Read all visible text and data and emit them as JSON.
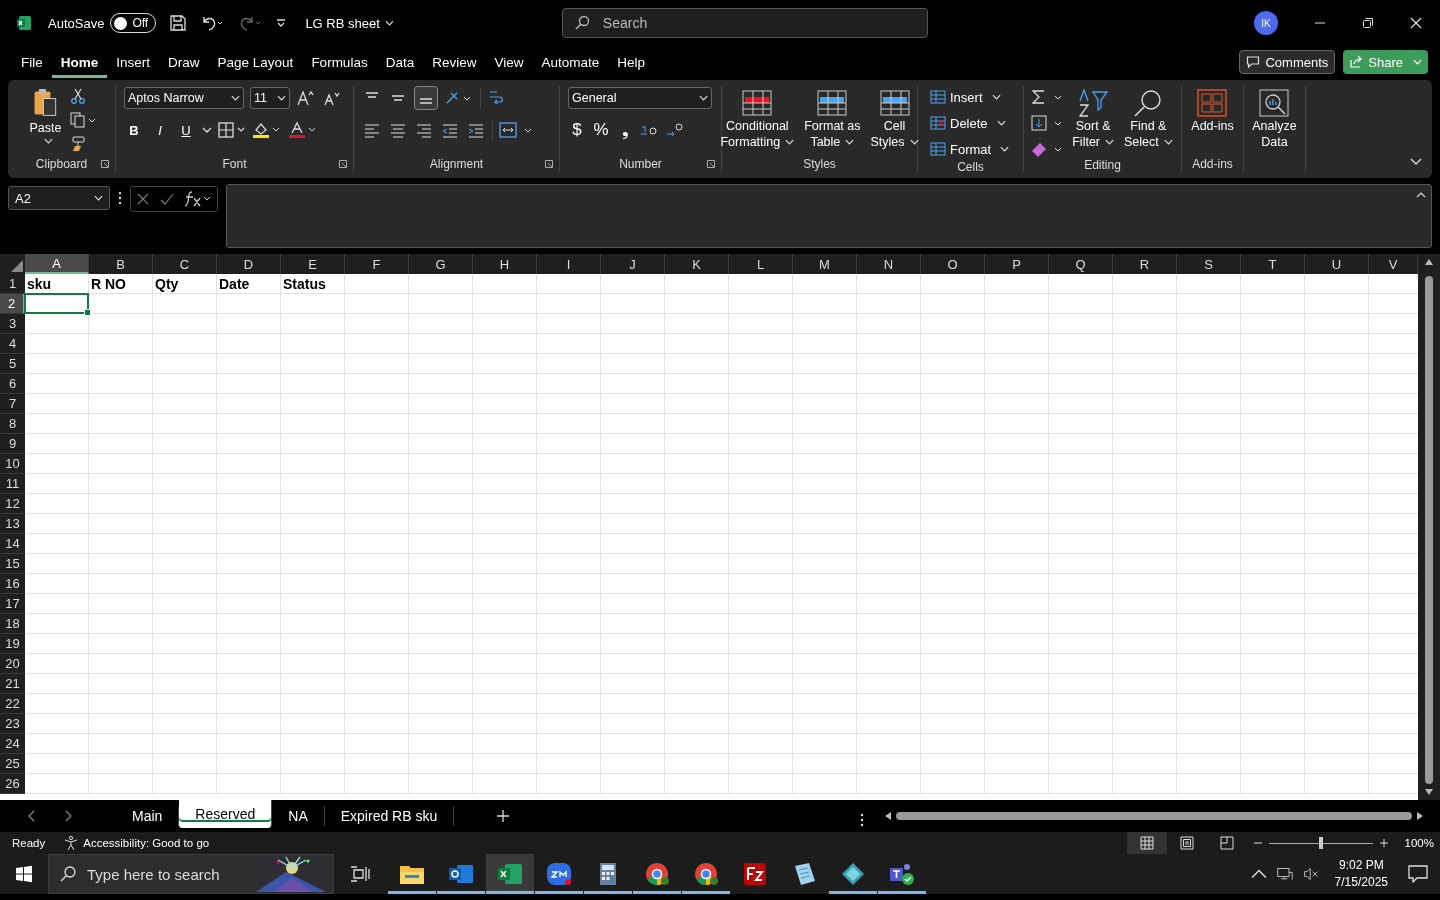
{
  "title_bar": {
    "autosave_label": "AutoSave",
    "autosave_toggle": {
      "label": "Off",
      "on": false
    },
    "document_title": "LG RB sheet",
    "search": {
      "placeholder": "Search"
    },
    "avatar": "IK"
  },
  "menu_tabs": [
    {
      "label": "File",
      "selected": false
    },
    {
      "label": "Home",
      "selected": true
    },
    {
      "label": "Insert",
      "selected": false
    },
    {
      "label": "Draw",
      "selected": false
    },
    {
      "label": "Page Layout",
      "selected": false
    },
    {
      "label": "Formulas",
      "selected": false
    },
    {
      "label": "Data",
      "selected": false
    },
    {
      "label": "Review",
      "selected": false
    },
    {
      "label": "View",
      "selected": false
    },
    {
      "label": "Automate",
      "selected": false
    },
    {
      "label": "Help",
      "selected": false
    }
  ],
  "comments_button": "Comments",
  "share_button": "Share",
  "ribbon": {
    "clipboard": {
      "paste": "Paste",
      "label": "Clipboard"
    },
    "font": {
      "name": "Aptos Narrow",
      "size": "11",
      "styles": [
        "B",
        "I",
        "U"
      ],
      "label": "Font"
    },
    "alignment": {
      "label": "Alignment"
    },
    "number": {
      "format": "General",
      "symbols": [
        "$",
        "%",
        "❟"
      ],
      "label": "Number"
    },
    "styles": {
      "buttons": [
        [
          "Conditional",
          "Formatting"
        ],
        [
          "Format as",
          "Table"
        ],
        [
          "Cell",
          "Styles"
        ]
      ],
      "label": "Styles"
    },
    "cells": {
      "items": [
        "Insert",
        "Delete",
        "Format"
      ],
      "label": "Cells"
    },
    "editing": {
      "buttons": [
        [
          "Sort &",
          "Filter"
        ],
        [
          "Find &",
          "Select"
        ]
      ],
      "label": "Editing"
    },
    "addins": {
      "button": "Add-ins",
      "label": "Add-ins"
    },
    "analyze": [
      "Analyze",
      "Data"
    ]
  },
  "name_box": "A2",
  "grid": {
    "columns": [
      {
        "label": "A",
        "selected": true
      },
      {
        "label": "B",
        "selected": false
      },
      {
        "label": "C",
        "selected": false
      },
      {
        "label": "D",
        "selected": false
      },
      {
        "label": "E",
        "selected": false
      },
      {
        "label": "F",
        "selected": false
      },
      {
        "label": "G",
        "selected": false
      },
      {
        "label": "H",
        "selected": false
      },
      {
        "label": "I",
        "selected": false
      },
      {
        "label": "J",
        "selected": false
      },
      {
        "label": "K",
        "selected": false
      },
      {
        "label": "L",
        "selected": false
      },
      {
        "label": "M",
        "selected": false
      },
      {
        "label": "N",
        "selected": false
      },
      {
        "label": "O",
        "selected": false
      },
      {
        "label": "P",
        "selected": false
      },
      {
        "label": "Q",
        "selected": false
      },
      {
        "label": "R",
        "selected": false
      },
      {
        "label": "S",
        "selected": false
      },
      {
        "label": "T",
        "selected": false
      },
      {
        "label": "U",
        "selected": false
      },
      {
        "label": "V",
        "selected": false
      }
    ],
    "rows": [
      {
        "label": "1",
        "selected": false,
        "cells": [
          "sku",
          "R NO",
          "Qty",
          "Date",
          "Status"
        ]
      },
      {
        "label": "2",
        "selected": true
      },
      {
        "label": "3",
        "selected": false
      },
      {
        "label": "4",
        "selected": false
      },
      {
        "label": "5",
        "selected": false
      },
      {
        "label": "6",
        "selected": false
      },
      {
        "label": "7",
        "selected": false
      },
      {
        "label": "8",
        "selected": false
      },
      {
        "label": "9",
        "selected": false
      },
      {
        "label": "10",
        "selected": false
      },
      {
        "label": "11",
        "selected": false
      },
      {
        "label": "12",
        "selected": false
      },
      {
        "label": "13",
        "selected": false
      },
      {
        "label": "14",
        "selected": false
      },
      {
        "label": "15",
        "selected": false
      },
      {
        "label": "16",
        "selected": false
      },
      {
        "label": "17",
        "selected": false
      },
      {
        "label": "18",
        "selected": false
      },
      {
        "label": "19",
        "selected": false
      },
      {
        "label": "20",
        "selected": false
      },
      {
        "label": "21",
        "selected": false
      },
      {
        "label": "22",
        "selected": false
      },
      {
        "label": "23",
        "selected": false
      },
      {
        "label": "24",
        "selected": false
      },
      {
        "label": "25",
        "selected": false
      },
      {
        "label": "26",
        "selected": false
      }
    ]
  },
  "sheet_tabs": [
    {
      "label": "Main",
      "selected": false
    },
    {
      "label": "Reserved",
      "selected": true
    },
    {
      "label": "NA",
      "selected": false
    },
    {
      "label": "Expired RB sku",
      "selected": false
    }
  ],
  "status_bar": {
    "ready": "Ready",
    "accessibility": "Accessibility: Good to go",
    "views": [
      {
        "kind": "normal",
        "selected": true
      },
      {
        "kind": "page_layout",
        "selected": false
      },
      {
        "kind": "page_break",
        "selected": false
      }
    ],
    "zoom": {
      "level": 0.5
    },
    "zoom_text": "100%"
  },
  "taskbar": {
    "search": {
      "placeholder": "Type here to search"
    },
    "apps": [
      {
        "kind": "explorer",
        "running": true,
        "selected": false
      },
      {
        "kind": "outlook",
        "running": true,
        "selected": false
      },
      {
        "kind": "excel",
        "running": true,
        "selected": true
      },
      {
        "kind": "zoom",
        "running": true,
        "selected": false
      },
      {
        "kind": "calculator",
        "running": true,
        "selected": false
      },
      {
        "kind": "chrome",
        "running": true,
        "selected": false
      },
      {
        "kind": "chrome",
        "running": true,
        "selected": false
      },
      {
        "kind": "filezilla",
        "running": false,
        "selected": false
      },
      {
        "kind": "notepad",
        "running": false,
        "selected": false
      },
      {
        "kind": "diamond",
        "running": true,
        "selected": false
      },
      {
        "kind": "teams",
        "running": true,
        "selected": false
      }
    ],
    "time": "9:02 PM",
    "date": "7/15/2025"
  }
}
